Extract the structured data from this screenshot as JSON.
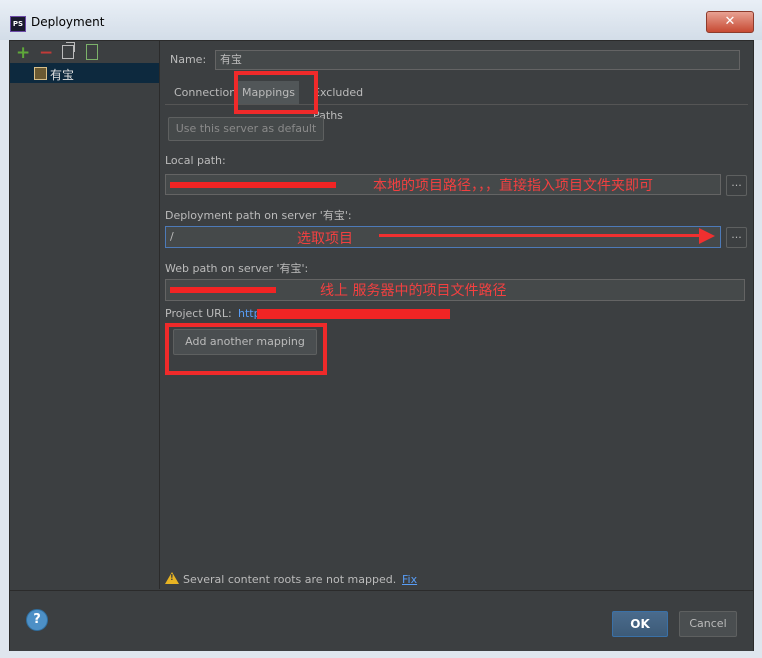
{
  "window": {
    "title": "Deployment",
    "app_icon": "PS"
  },
  "sidebar": {
    "items": [
      {
        "label": "有宝"
      }
    ]
  },
  "form": {
    "name_label": "Name:",
    "name_value": "有宝",
    "tabs": [
      {
        "label": "Connection"
      },
      {
        "label": "Mappings"
      },
      {
        "label": "Excluded Paths"
      }
    ],
    "use_default_button": "Use this server as default",
    "local_path_label": "Local path:",
    "deployment_path_label": "Deployment path on server '有宝':",
    "deployment_path_value": "/",
    "web_path_label": "Web path on server '有宝':",
    "project_url_label": "Project URL:",
    "project_url_value": "http",
    "add_mapping_button": "Add another mapping",
    "warning_text": "Several content roots are not mapped.",
    "fix_link": "Fix",
    "browse_label": "..."
  },
  "annotations": {
    "local_path": "本地的项目路径，，，直接指入项目文件夹即可",
    "deployment_path": "选取项目",
    "web_path": "线上 服务器中的项目文件路径"
  },
  "footer": {
    "help_label": "?",
    "ok_label": "OK",
    "cancel_label": "Cancel"
  },
  "colors": {
    "annotation_red": "#f22424",
    "link_blue": "#589df6"
  }
}
